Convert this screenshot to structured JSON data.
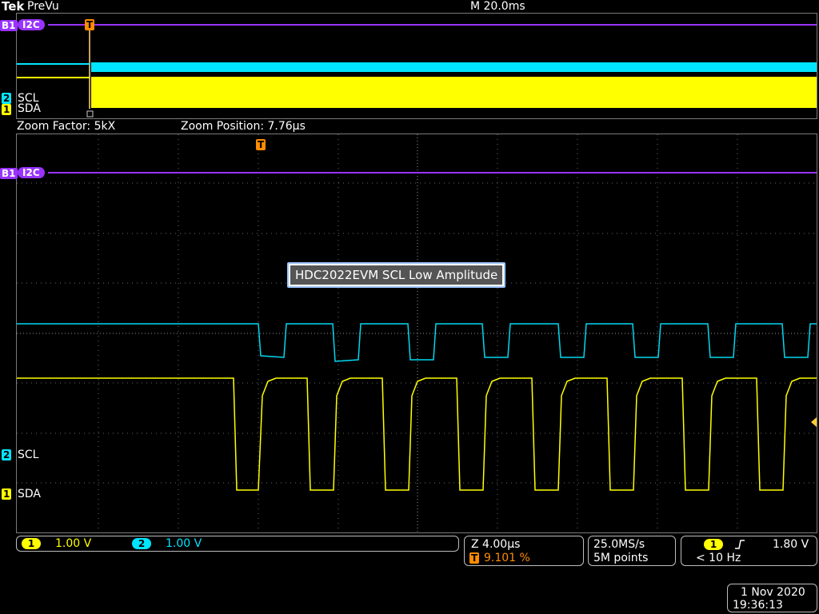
{
  "header": {
    "brand": "Tek",
    "mode": "PreVu",
    "timebase": "M 20.0ms"
  },
  "overview": {
    "bus_label": "I2C",
    "bus_marker": "B1",
    "trigger_marker": "T",
    "ch2_marker": "2",
    "ch1_marker": "1",
    "ch2_label": "SCL",
    "ch1_label": "SDA"
  },
  "zoom": {
    "factor_text": "Zoom Factor: 5kX",
    "position_text": "Zoom Position: 7.76µs",
    "bus_label": "I2C",
    "bus_marker": "B1",
    "trigger_marker": "T",
    "ch2_marker": "2",
    "ch1_marker": "1",
    "ch2_label": "SCL",
    "ch1_label": "SDA"
  },
  "annotation": "HDC2022EVM SCL Low Amplitude",
  "status": {
    "ch1_badge": "1",
    "ch1_scale": "1.00 V",
    "ch2_badge": "2",
    "ch2_scale": "1.00 V",
    "zoom_scale": "Z 4.00µs",
    "trigger_badge": "T",
    "trigger_pos": "9.101 %",
    "sample_rate": "25.0MS/s",
    "record_length": "5M points",
    "trig_source_badge": "1",
    "trig_slope_icon": "rising-edge-icon",
    "trig_level": "1.80 V",
    "trig_freq": "< 10 Hz",
    "date": "1 Nov 2020",
    "time": "19:36:13"
  },
  "colors": {
    "ch1": "#ffff00",
    "ch2": "#00e5ff",
    "bus": "#9933ff",
    "trigger": "#ff8c00"
  }
}
